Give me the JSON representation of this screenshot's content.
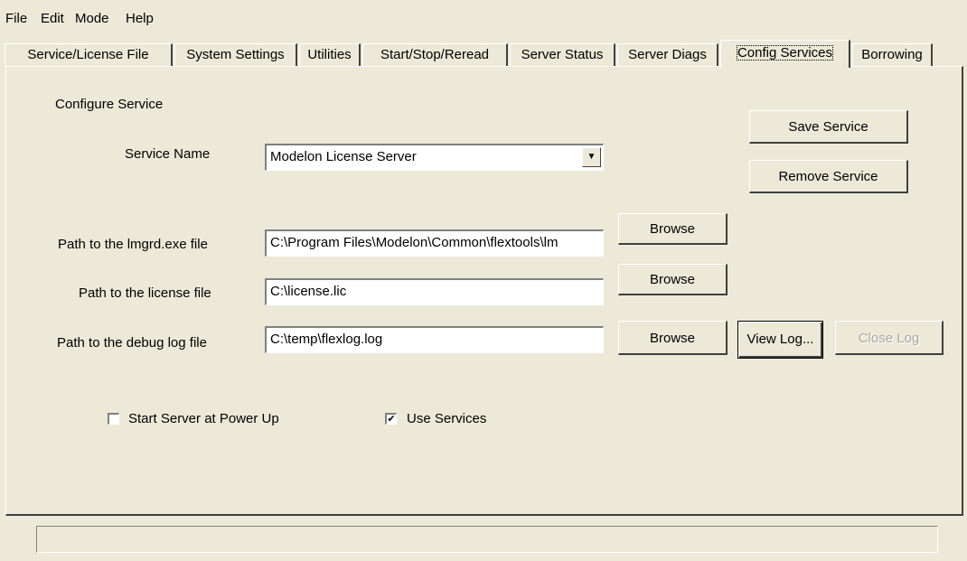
{
  "menu": [
    "File",
    "Edit",
    "Mode",
    "Help"
  ],
  "tabs": [
    {
      "label": "Service/License File"
    },
    {
      "label": "System Settings"
    },
    {
      "label": "Utilities"
    },
    {
      "label": "Start/Stop/Reread"
    },
    {
      "label": "Server Status"
    },
    {
      "label": "Server Diags"
    },
    {
      "label": "Config Services",
      "active": true
    },
    {
      "label": "Borrowing"
    }
  ],
  "config": {
    "section_title": "Configure Service",
    "service_name_label": "Service Name",
    "service_name_value": "Modelon License Server",
    "lmgrd_label": "Path to the lmgrd.exe file",
    "lmgrd_value": "C:\\Program Files\\Modelon\\Common\\flextools\\lm",
    "license_label": "Path to the license file",
    "license_value": "C:\\license.lic",
    "debug_label": "Path to the debug log file",
    "debug_value": "C:\\temp\\flexlog.log",
    "browse_label": "Browse",
    "save_service": "Save Service",
    "remove_service": "Remove Service",
    "view_log": "View Log...",
    "close_log": "Close Log",
    "start_at_powerup_label": "Start Server at Power Up",
    "start_at_powerup_checked": false,
    "use_services_label": "Use Services",
    "use_services_checked": true
  },
  "status_text": ""
}
